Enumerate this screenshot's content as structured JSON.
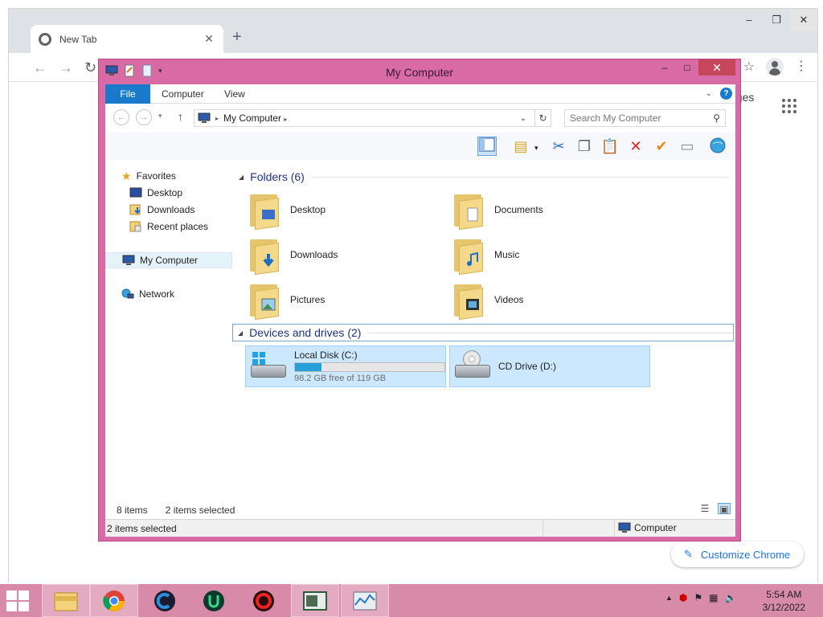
{
  "chrome": {
    "tab_title": "New Tab",
    "images_link": "ages",
    "customize_label": "Customize Chrome",
    "icons": [
      "chrome-icon",
      "close-icon",
      "new-tab-plus-icon",
      "back-arrow-icon",
      "forward-arrow-icon",
      "reload-icon",
      "star-icon",
      "profile-icon",
      "menu-kebab-icon",
      "apps-grid-icon",
      "pencil-icon"
    ]
  },
  "explorer": {
    "title": "My Computer",
    "ribbon_tabs": [
      "File",
      "Computer",
      "View"
    ],
    "address_path": "My Computer",
    "search_placeholder": "Search My Computer",
    "nav": {
      "favorites": "Favorites",
      "desktop": "Desktop",
      "downloads": "Downloads",
      "recent": "Recent places",
      "my_computer": "My Computer",
      "network": "Network"
    },
    "folders_header": "Folders (6)",
    "folders": [
      "Desktop",
      "Documents",
      "Downloads",
      "Music",
      "Pictures",
      "Videos"
    ],
    "drives_header": "Devices and drives (2)",
    "drives": [
      {
        "name": "Local Disk (C:)",
        "free_text": "98.2 GB free of 119 GB",
        "used_fraction": 0.175
      },
      {
        "name": "CD Drive (D:)"
      }
    ],
    "status_items": "8 items",
    "status_selected": "2 items selected",
    "statusbar_left": "2 items selected",
    "statusbar_right": "Computer"
  },
  "taskbar": {
    "time": "5:54 AM",
    "date": "3/12/2022",
    "apps": [
      "file-explorer",
      "chrome",
      "ccleaner",
      "uplay",
      "app-red",
      "app-window",
      "task-manager"
    ]
  },
  "colors": {
    "accent_window": "#d86aa5",
    "taskbar": "#d88aa9",
    "file_tab": "#1979ca",
    "selection": "#cce8ff",
    "drive_bar": "#26a0da"
  }
}
